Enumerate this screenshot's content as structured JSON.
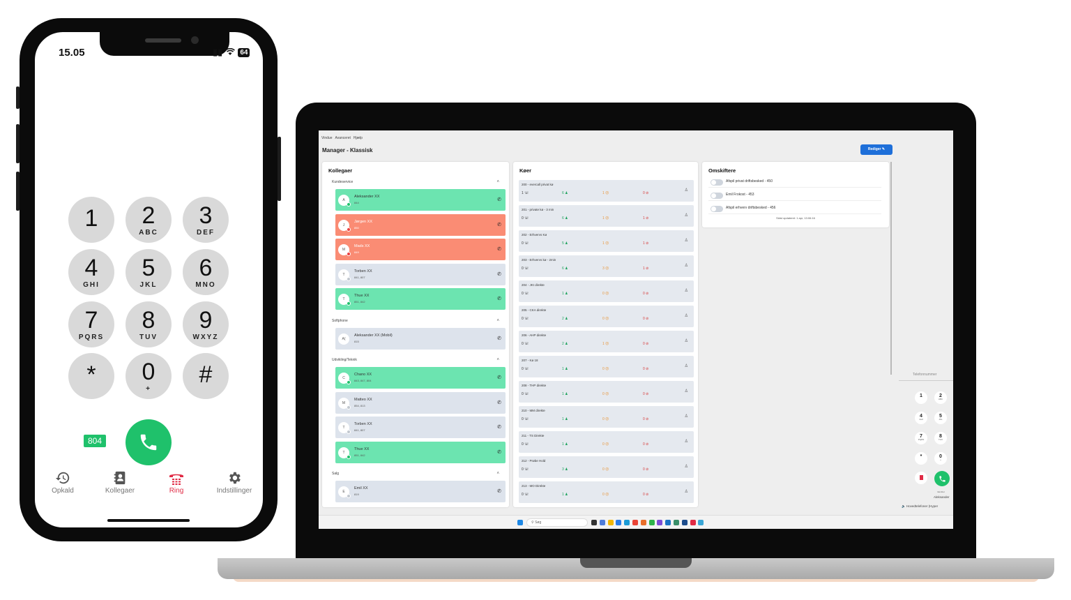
{
  "phone": {
    "time": "15.05",
    "battery": "64",
    "keys": [
      {
        "digit": "1",
        "letters": ""
      },
      {
        "digit": "2",
        "letters": "ABC"
      },
      {
        "digit": "3",
        "letters": "DEF"
      },
      {
        "digit": "4",
        "letters": "GHI"
      },
      {
        "digit": "5",
        "letters": "JKL"
      },
      {
        "digit": "6",
        "letters": "MNO"
      },
      {
        "digit": "7",
        "letters": "PQRS"
      },
      {
        "digit": "8",
        "letters": "TUV"
      },
      {
        "digit": "9",
        "letters": "WXYZ"
      },
      {
        "digit": "*",
        "letters": ""
      },
      {
        "digit": "0",
        "letters": "+"
      },
      {
        "digit": "#",
        "letters": ""
      }
    ],
    "extension": "804",
    "tabs": [
      {
        "label": "Opkald",
        "icon": "history-icon"
      },
      {
        "label": "Kollegaer",
        "icon": "contacts-icon"
      },
      {
        "label": "Ring",
        "icon": "phone-keypad-icon",
        "active": true
      },
      {
        "label": "Indstillinger",
        "icon": "gear-icon"
      }
    ],
    "accent_color": "#1fc16b",
    "active_tab_color": "#e02b45"
  },
  "desktop": {
    "menu": [
      "Vindue",
      "Avanceret",
      "Hjælp"
    ],
    "app_title": "Manager - Klassisk",
    "edit_button": "Rediger",
    "colleagues": {
      "title": "Kollegaer",
      "groups": [
        {
          "name": "Kundeservice",
          "members": [
            {
              "initial": "A",
              "name": "Aleksander XX",
              "ext": "844",
              "status": "green",
              "dot": "on"
            },
            {
              "initial": "J",
              "name": "Jørgen XX",
              "ext": "850",
              "status": "red",
              "dot": "busy"
            },
            {
              "initial": "M",
              "name": "Mads XX",
              "ext": "849",
              "status": "red",
              "dot": "busy"
            },
            {
              "initial": "T",
              "name": "Torben XX",
              "ext": "841, 807",
              "status": "gray",
              "dot": "off"
            },
            {
              "initial": "T",
              "name": "Thue XX",
              "ext": "851, 842",
              "status": "green",
              "dot": "on"
            }
          ]
        },
        {
          "name": "Softphone",
          "members": [
            {
              "initial": "A(",
              "name": "Aleksander XX (Mobil)",
              "ext": "815",
              "status": "gray",
              "dot": "none"
            }
          ]
        },
        {
          "name": "Udvikling/Teknik",
          "members": [
            {
              "initial": "C",
              "name": "Chano XX",
              "ext": "843, 847, 804",
              "status": "green",
              "dot": "on"
            },
            {
              "initial": "M",
              "name": "Matteo XX",
              "ext": "854, 813",
              "status": "gray",
              "dot": "off"
            },
            {
              "initial": "T",
              "name": "Torben XX",
              "ext": "841, 807",
              "status": "gray",
              "dot": "off"
            },
            {
              "initial": "T",
              "name": "Thue XX",
              "ext": "851, 842",
              "status": "green",
              "dot": "on"
            }
          ]
        },
        {
          "name": "Salg",
          "members": [
            {
              "initial": "E",
              "name": "Emil XX",
              "ext": "819",
              "status": "gray",
              "dot": "off"
            }
          ]
        }
      ]
    },
    "queues": {
      "title": "Køer",
      "items": [
        {
          "name": "200 - evercall privat kø",
          "a": "1",
          "b": "6",
          "c": "1",
          "d": "0"
        },
        {
          "name": "201 - private kø - 3 min",
          "a": "0",
          "b": "6",
          "c": "1",
          "d": "1"
        },
        {
          "name": "202 - Erhvervs Kø",
          "a": "0",
          "b": "5",
          "c": "1",
          "d": "1"
        },
        {
          "name": "203 - Erhvervs kø - 2min",
          "a": "0",
          "b": "6",
          "c": "3",
          "d": "1"
        },
        {
          "name": "204 - JKI direkte",
          "a": "0",
          "b": "1",
          "c": "0",
          "d": "0"
        },
        {
          "name": "205 - CKA direkte",
          "a": "0",
          "b": "2",
          "c": "0",
          "d": "0"
        },
        {
          "name": "206 - AHP direkte",
          "a": "0",
          "b": "2",
          "c": "1",
          "d": "0"
        },
        {
          "name": "207 - Kø 18",
          "a": "0",
          "b": "1",
          "c": "0",
          "d": "0"
        },
        {
          "name": "208 - THP direkte",
          "a": "0",
          "b": "1",
          "c": "0",
          "d": "0"
        },
        {
          "name": "210 - MM direkte",
          "a": "0",
          "b": "1",
          "c": "0",
          "d": "0"
        },
        {
          "name": "211 - TS Direkte",
          "a": "0",
          "b": "1",
          "c": "0",
          "d": "0"
        },
        {
          "name": "212 - Prøbe Hold",
          "a": "0",
          "b": "3",
          "c": "0",
          "d": "0"
        },
        {
          "name": "213 - MO Direkte",
          "a": "0",
          "b": "1",
          "c": "0",
          "d": "0"
        }
      ]
    },
    "switches": {
      "title": "Omskiftere",
      "items": [
        {
          "label": "Afspil privat driftsbesked - 450"
        },
        {
          "label": "Emil Frokost - 453"
        },
        {
          "label": "Afspil erhverv driftsbesked - 456"
        }
      ],
      "updated": "Sidst opdateret: 1 apr, 13:06:16"
    },
    "side_dialer": {
      "placeholder": "Telefonnummer",
      "keys": [
        {
          "digit": "1",
          "letters": ""
        },
        {
          "digit": "2",
          "letters": "ABC"
        },
        {
          "digit": "4",
          "letters": "GHI"
        },
        {
          "digit": "5",
          "letters": "JKL"
        },
        {
          "digit": "7",
          "letters": "PQRS"
        },
        {
          "digit": "8",
          "letters": "TUV"
        },
        {
          "digit": "*",
          "letters": ""
        },
        {
          "digit": "0",
          "letters": "+"
        }
      ],
      "caller_label": "Identitet",
      "caller_name": "Aleksander",
      "audio_device": "Hovedtelefoner (Hyper"
    },
    "taskbar": {
      "search": "Søg"
    }
  }
}
